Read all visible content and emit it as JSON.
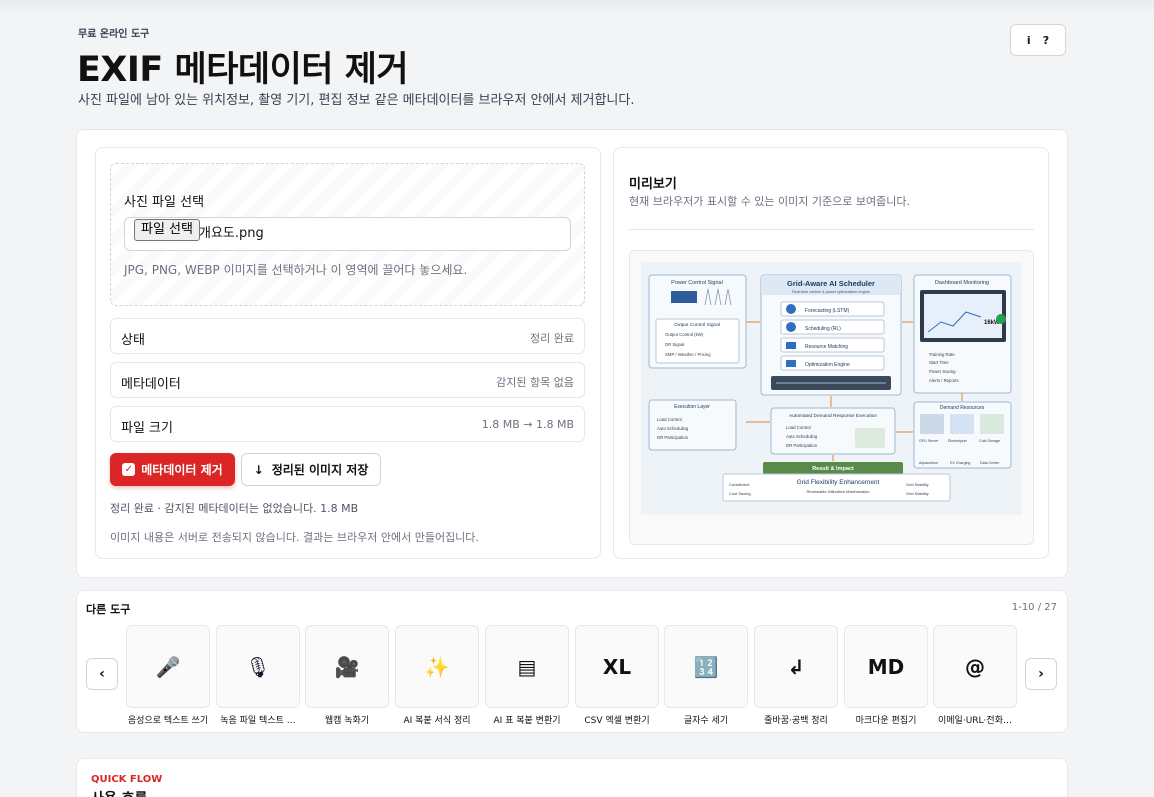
{
  "header": {
    "eyebrow": "무료 온라인 도구",
    "title": "EXIF 메타데이터 제거",
    "subtitle": "사진 파일에 남아 있는 위치정보, 촬영 기기, 편집 정보 같은 메타데이터를 브라우저 안에서 제거합니다.",
    "info_label": "i",
    "help_label": "?"
  },
  "upload": {
    "label": "사진 파일 선택",
    "file_button": "파일 선택",
    "file_name": "개요도.png",
    "hint": "JPG, PNG, WEBP 이미지를 선택하거나 이 영역에 끌어다 놓으세요."
  },
  "info_rows": [
    {
      "key": "상태",
      "value": "정리 완료"
    },
    {
      "key": "메타데이터",
      "value": "감지된 항목 없음"
    },
    {
      "key": "파일 크기",
      "value": "1.8 MB → 1.8 MB"
    }
  ],
  "actions": {
    "remove_label": "메타데이터 제거",
    "save_label": "정리된 이미지 저장",
    "status_line": "정리 완료 · 감지된 메타데이터는 없었습니다. 1.8 MB",
    "privacy_line": "이미지 내용은 서버로 전송되지 않습니다. 결과는 브라우저 안에서 만들어집니다."
  },
  "preview": {
    "title": "미리보기",
    "desc": "현재 브라우저가 표시할 수 있는 이미지 기준으로 보여줍니다.",
    "diagram": {
      "power_title": "Power Control Signal",
      "output_title": "Output Control Signal",
      "output_items": [
        "Output Control (kW)",
        "DR Signal",
        "SMP / Weather / Pricing"
      ],
      "scheduler_title": "Grid-Aware AI Scheduler",
      "scheduler_sub": "Real-time carbon & power optimization engine",
      "modules": [
        "Forecasting (LSTM)",
        "Scheduling (RL)",
        "Resource Matching",
        "Optimization Engine"
      ],
      "dashboard_title": "Dashboard Monitoring",
      "dashboard_value": "16kW",
      "dashboard_items": [
        "Training Rate",
        "Start Time",
        "Power Saving",
        "Alerts / Reports"
      ],
      "execution_title": "Execution Layer",
      "execution_items": [
        "Load Control",
        "Auto Scheduling",
        "DR Participation"
      ],
      "adr_title": "Automated Demand Response Execution",
      "adr_items": [
        "Load Control",
        "Auto Scheduling",
        "DR Participation"
      ],
      "demand_title": "Demand Resources",
      "demand_items": [
        "GPU Server",
        "Electrolyzer",
        "Cold Storage",
        "Aquaculture",
        "EV Charging",
        "Data Center"
      ],
      "result_title": "Result & Impact",
      "result_main": "Grid Flexibility Enhancement",
      "result_items": [
        "Curtailment",
        "Cost Saving",
        "Renewable Utilization Maximization",
        "Grid Stability",
        "Grid Stability"
      ]
    }
  },
  "tools": {
    "title": "다른 도구",
    "count": "1-10 / 27",
    "prev": "‹",
    "next": "›",
    "items": [
      {
        "label": "음성으로 텍스트 쓰기",
        "icon": "🎤"
      },
      {
        "label": "녹음 파일 텍스트 …",
        "icon": "🎙"
      },
      {
        "label": "웹캠 녹화기",
        "icon": "🎥"
      },
      {
        "label": "AI 복붙 서식 정리",
        "icon": "✨"
      },
      {
        "label": "AI 표 복붙 변환기",
        "icon": "▤"
      },
      {
        "label": "CSV 엑셀 변환기",
        "icon": "XL"
      },
      {
        "label": "글자수 세기",
        "icon": "🔢"
      },
      {
        "label": "줄바꿈·공백 정리",
        "icon": "↲"
      },
      {
        "label": "마크다운 편집기",
        "icon": "MD"
      },
      {
        "label": "이메일·URL·전화…",
        "icon": "@"
      }
    ]
  },
  "flow": {
    "eyebrow": "QUICK FLOW",
    "title": "사용 흐름"
  },
  "colors": {
    "accent": "#dc2626",
    "background": "#f3f4f6",
    "border": "#e5e7eb"
  }
}
